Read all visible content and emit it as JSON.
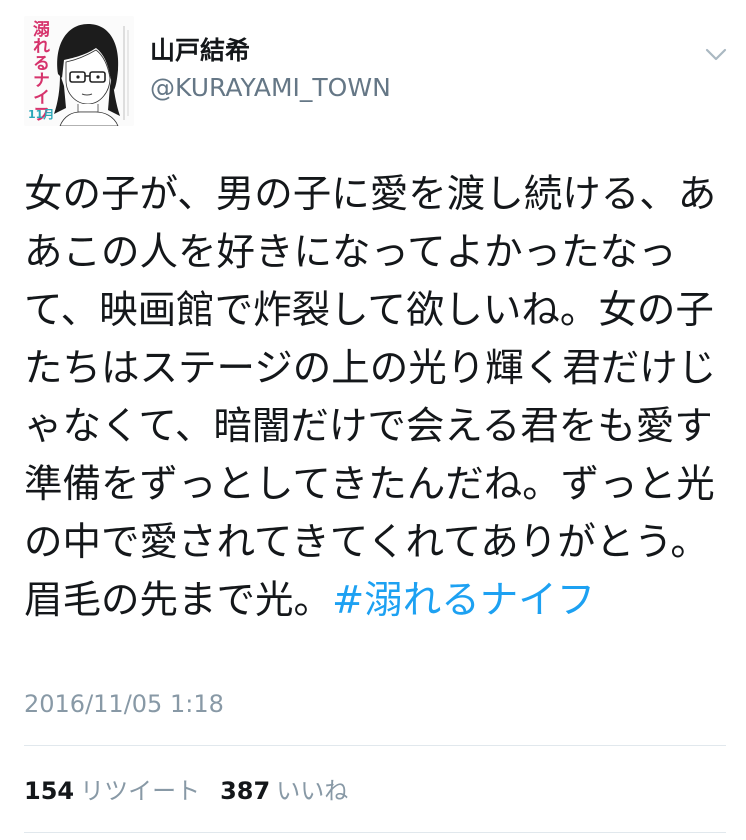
{
  "user": {
    "display_name": "山戸結希",
    "handle": "@KURAYAMI_TOWN",
    "avatar_logo_text": "溺れるナイフ",
    "avatar_volume_text": "11月"
  },
  "tweet": {
    "text": "女の子が、男の子に愛を渡し続ける、ああこの人を好きになってよかったなって、映画館で炸裂して欲しいね。女の子たちはステージの上の光り輝く君だけじゃなくて、暗闇だけで会える君をも愛す準備をずっとしてきたんだね。ずっと光の中で愛されてきてくれてありがとう。眉毛の先まで光。",
    "hashtag": "#溺れるナイフ",
    "timestamp": "2016/11/05 1:18"
  },
  "stats": {
    "retweets_count": "154",
    "retweets_label": "リツイート",
    "likes_count": "387",
    "likes_label": "いいね"
  },
  "colors": {
    "link": "#1da1f2",
    "secondary_text": "#8899a6",
    "avatar_logo": "#d6336c",
    "avatar_volume": "#2aa7b8"
  }
}
